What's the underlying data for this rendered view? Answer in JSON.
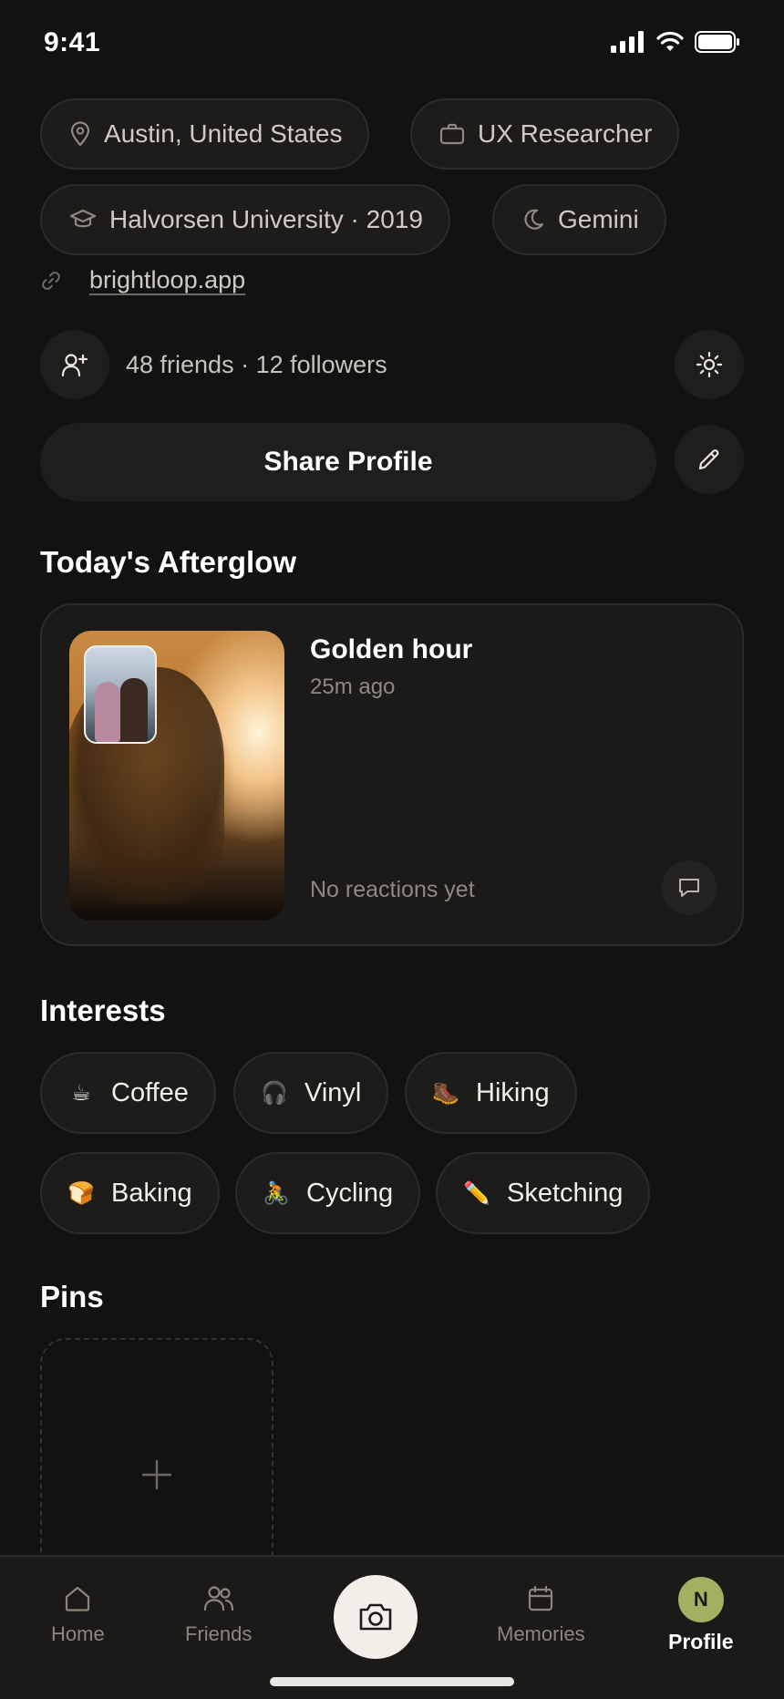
{
  "status": {
    "time": "9:41"
  },
  "details": {
    "location": "Austin, United States",
    "job": "UX Researcher",
    "education": "Halvorsen University · 2019",
    "zodiac": "Gemini",
    "website": "brightloop.app"
  },
  "social": {
    "summary": "48 friends · 12 followers"
  },
  "actions": {
    "share_label": "Share Profile"
  },
  "afterglow": {
    "section_title": "Today's Afterglow",
    "title": "Golden hour",
    "time": "25m ago",
    "reactions": "No reactions yet"
  },
  "interests": {
    "section_title": "Interests",
    "items": [
      {
        "emoji": "☕",
        "label": "Coffee"
      },
      {
        "emoji": "🎧",
        "label": "Vinyl"
      },
      {
        "emoji": "🥾",
        "label": "Hiking"
      },
      {
        "emoji": "🍞",
        "label": "Baking"
      },
      {
        "emoji": "🚴",
        "label": "Cycling"
      },
      {
        "emoji": "✏️",
        "label": "Sketching"
      }
    ]
  },
  "pins": {
    "section_title": "Pins"
  },
  "tabbar": {
    "home": "Home",
    "friends": "Friends",
    "memories": "Memories",
    "profile": "Profile",
    "avatar_initial": "N"
  },
  "colors": {
    "background": "#121212",
    "surface": "#1d1c1b",
    "avatar": "#a1b061",
    "camera_button": "#f2efe8"
  }
}
